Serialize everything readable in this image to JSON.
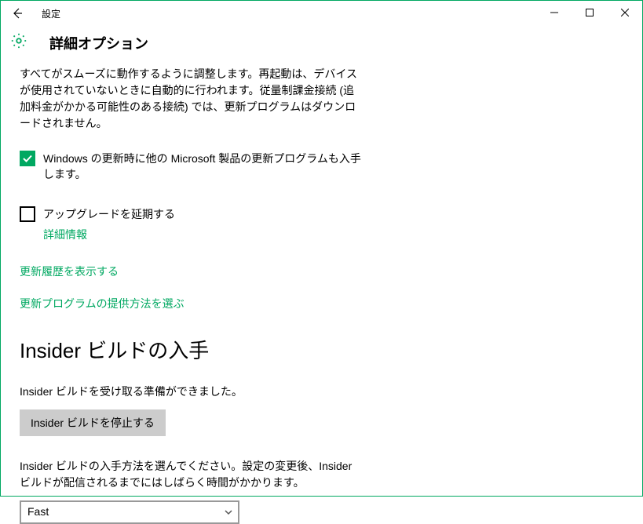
{
  "window": {
    "title": "設定"
  },
  "header": {
    "title": "詳細オプション"
  },
  "intro": {
    "text": "すべてがスムーズに動作するように調整します。再起動は、デバイスが使用されていないときに自動的に行われます。従量制課金接続 (追加料金がかかる可能性のある接続) では、更新プログラムはダウンロードされません。"
  },
  "checkboxes": {
    "ms_products": {
      "checked": true,
      "label": "Windows の更新時に他の Microsoft 製品の更新プログラムも入手します。"
    },
    "defer": {
      "checked": false,
      "label": "アップグレードを延期する",
      "info_link": "詳細情報"
    }
  },
  "links": {
    "history": "更新履歴を表示する",
    "delivery": "更新プログラムの提供方法を選ぶ"
  },
  "insider": {
    "title": "Insider ビルドの入手",
    "status": "Insider ビルドを受け取る準備ができました。",
    "stop_button": "Insider ビルドを停止する",
    "method_text": "Insider ビルドの入手方法を選んでください。設定の変更後、Insider ビルドが配信されるまでにはしばらく時間がかかります。",
    "ring_selected": "Fast"
  }
}
